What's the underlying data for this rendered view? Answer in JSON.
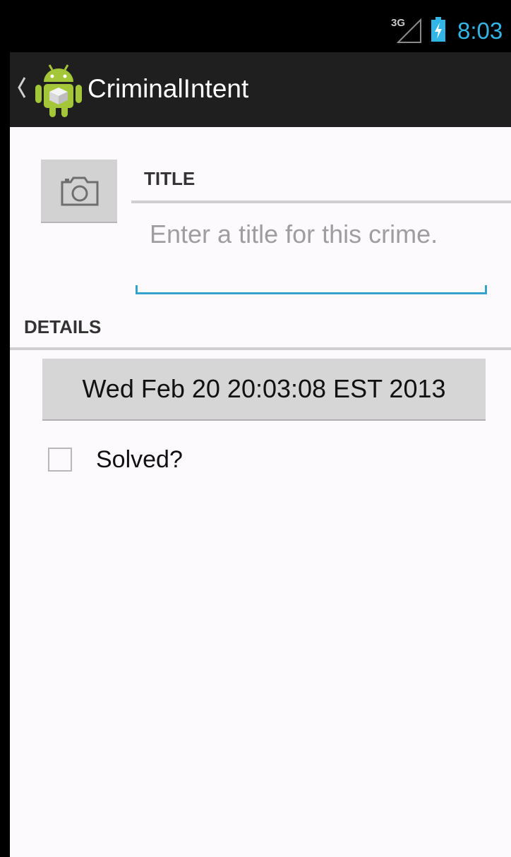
{
  "status_bar": {
    "network_type": "3G",
    "signal_icon": "signal-icon",
    "battery_icon": "battery-charging-icon",
    "time": "8:03",
    "time_color": "#33b5e5"
  },
  "action_bar": {
    "up_icon": "chevron-left-icon",
    "app_icon": "android-app-icon",
    "title": "CriminalIntent"
  },
  "crime_form": {
    "photo_button_icon": "camera-icon",
    "title_header": "TITLE",
    "title_input": {
      "value": "",
      "placeholder": "Enter a title for this crime."
    },
    "details_header": "DETAILS",
    "date_button_label": "Wed Feb 20 20:03:08 EST 2013",
    "solved": {
      "label": "Solved?",
      "checked": false
    }
  },
  "colors": {
    "accent": "#33a3cc",
    "action_bar": "#1f1f1f",
    "background": "#fdfafd"
  }
}
